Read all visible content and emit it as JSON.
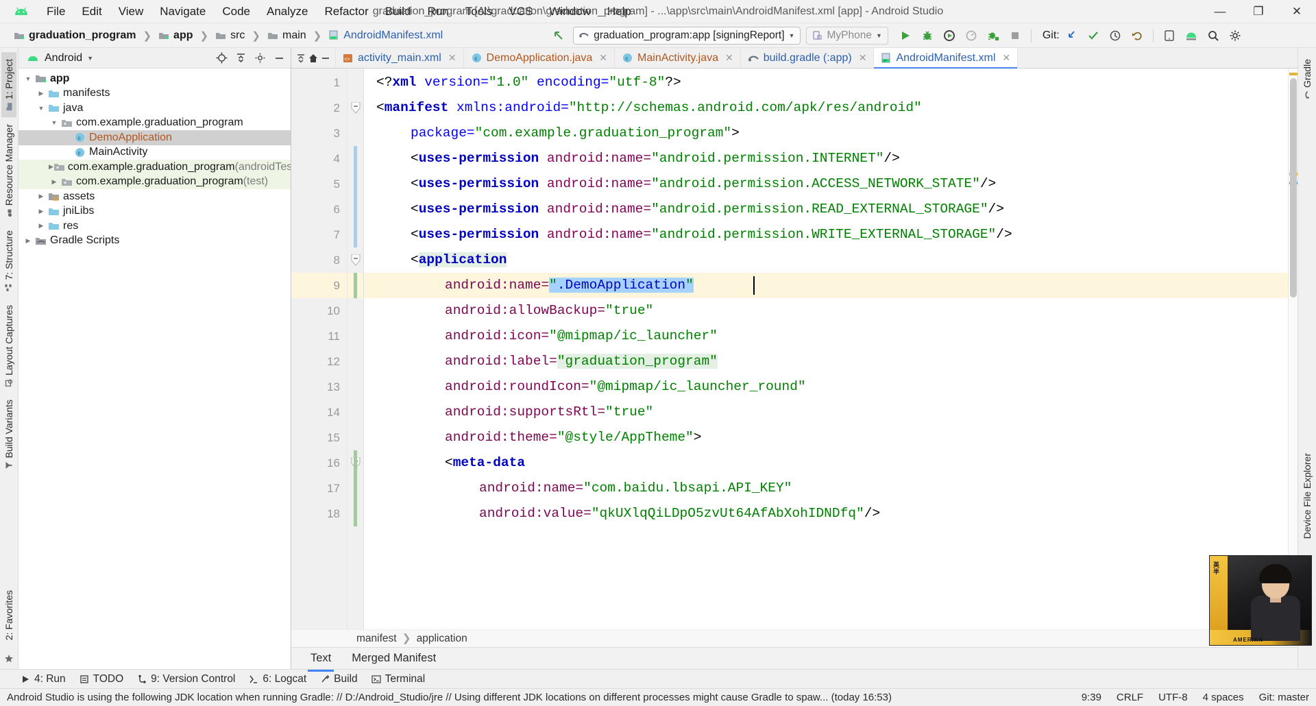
{
  "window": {
    "title": "graduation_program [A:\\graduation\\graduation_program] - ...\\app\\src\\main\\AndroidManifest.xml [app] - Android Studio",
    "minimize": "—",
    "maximize": "❐",
    "close": "✕"
  },
  "menu": [
    "File",
    "Edit",
    "View",
    "Navigate",
    "Code",
    "Analyze",
    "Refactor",
    "Build",
    "Run",
    "Tools",
    "VCS",
    "Window",
    "Help"
  ],
  "breadcrumbs": [
    {
      "label": "graduation_program",
      "icon": "folder-module-icon",
      "bold": true
    },
    {
      "label": "app",
      "icon": "folder-module-icon",
      "bold": true
    },
    {
      "label": "src",
      "icon": "folder-icon",
      "bold": false
    },
    {
      "label": "main",
      "icon": "folder-icon",
      "bold": false
    },
    {
      "label": "AndroidManifest.xml",
      "icon": "manifest-file-icon",
      "bold": false,
      "link": true
    }
  ],
  "toolbar": {
    "run_config": "graduation_program:app [signingReport]",
    "device": "MyPhone",
    "git_label": "Git:",
    "buttons": [
      "run-icon",
      "debug-icon",
      "run-coverage-icon",
      "profiler-icon",
      "attach-debugger-icon",
      "stop-icon"
    ],
    "git_buttons": [
      "update-project-icon",
      "commit-icon",
      "history-icon",
      "rollback-icon"
    ],
    "right_buttons": [
      "avd-manager-icon",
      "sdk-manager-icon",
      "search-everywhere-icon",
      "settings-icon"
    ]
  },
  "left_tool_tabs": [
    {
      "label": "1: Project",
      "icon": "project-icon",
      "active": true
    },
    {
      "label": "Resource Manager",
      "icon": "resource-manager-icon",
      "active": false
    },
    {
      "label": "7: Structure",
      "icon": "structure-icon",
      "active": false
    },
    {
      "label": "Layout Captures",
      "icon": "layout-captures-icon",
      "active": false
    },
    {
      "label": "Build Variants",
      "icon": "build-variants-icon",
      "active": false
    },
    {
      "label": "2: Favorites",
      "icon": "favorites-icon",
      "active": false
    }
  ],
  "right_tool_tabs": [
    {
      "label": "Gradle",
      "icon": "gradle-icon"
    },
    {
      "label": "Device File Explorer",
      "icon": "device-file-explorer-icon"
    }
  ],
  "project_panel": {
    "view_selector": "Android",
    "actions": [
      "locate-icon",
      "collapse-all-icon",
      "settings-icon",
      "hide-icon"
    ],
    "tree": [
      {
        "label": "app",
        "depth": 0,
        "arrow": "open",
        "icon": "module-folder-icon",
        "bold": true,
        "state": "normal"
      },
      {
        "label": "manifests",
        "depth": 1,
        "arrow": "closed",
        "icon": "folder-blue-icon",
        "bold": false,
        "state": "normal"
      },
      {
        "label": "java",
        "depth": 1,
        "arrow": "open",
        "icon": "folder-blue-icon",
        "bold": false,
        "state": "normal"
      },
      {
        "label": "com.example.graduation_program",
        "depth": 2,
        "arrow": "open",
        "icon": "package-icon",
        "bold": false,
        "state": "normal"
      },
      {
        "label": "DemoApplication",
        "depth": 3,
        "arrow": "none",
        "icon": "class-icon",
        "bold": false,
        "state": "selected",
        "color": "orange"
      },
      {
        "label": "MainActivity",
        "depth": 3,
        "arrow": "none",
        "icon": "class-icon",
        "bold": false,
        "state": "normal"
      },
      {
        "label": "com.example.graduation_program",
        "suffix": " (androidTest)",
        "depth": 2,
        "arrow": "closed",
        "icon": "package-icon",
        "bold": false,
        "state": "testsrc"
      },
      {
        "label": "com.example.graduation_program",
        "suffix": " (test)",
        "depth": 2,
        "arrow": "closed",
        "icon": "package-icon",
        "bold": false,
        "state": "testsrc"
      },
      {
        "label": "assets",
        "depth": 1,
        "arrow": "closed",
        "icon": "assets-folder-icon",
        "bold": false,
        "state": "normal"
      },
      {
        "label": "jniLibs",
        "depth": 1,
        "arrow": "closed",
        "icon": "folder-blue-icon",
        "bold": false,
        "state": "normal"
      },
      {
        "label": "res",
        "depth": 1,
        "arrow": "closed",
        "icon": "folder-blue-icon",
        "bold": false,
        "state": "normal"
      },
      {
        "label": "Gradle Scripts",
        "depth": 0,
        "arrow": "closed",
        "icon": "gradle-scripts-icon",
        "bold": false,
        "state": "normal"
      }
    ]
  },
  "editor_tabs": [
    {
      "label": "activity_main.xml",
      "icon": "xml-layout-icon",
      "color": "blue",
      "active": false
    },
    {
      "label": "DemoApplication.java",
      "icon": "class-icon",
      "color": "orange",
      "active": false
    },
    {
      "label": "MainActivity.java",
      "icon": "class-icon",
      "color": "orange",
      "active": false
    },
    {
      "label": "build.gradle (:app)",
      "icon": "gradle-icon",
      "color": "blue",
      "active": false
    },
    {
      "label": "AndroidManifest.xml",
      "icon": "manifest-file-icon",
      "color": "blue",
      "active": true
    }
  ],
  "code": {
    "first_line": 1,
    "lines": [
      {
        "n": 1,
        "indent": 0,
        "tokens": [
          {
            "t": "<?",
            "c": "punc"
          },
          {
            "t": "xml",
            "c": "tag"
          },
          {
            "t": " version=",
            "c": "attr2"
          },
          {
            "t": "\"1.0\"",
            "c": "val"
          },
          {
            "t": " encoding=",
            "c": "attr2"
          },
          {
            "t": "\"utf-8\"",
            "c": "val"
          },
          {
            "t": "?>",
            "c": "punc"
          }
        ]
      },
      {
        "n": 2,
        "indent": 0,
        "tokens": [
          {
            "t": "<",
            "c": "punc"
          },
          {
            "t": "manifest",
            "c": "tag"
          },
          {
            "t": " xmlns:android=",
            "c": "attr2"
          },
          {
            "t": "\"http://schemas.android.com/apk/res/android\"",
            "c": "val"
          }
        ]
      },
      {
        "n": 3,
        "indent": 1,
        "tokens": [
          {
            "t": "package=",
            "c": "attr2"
          },
          {
            "t": "\"com.example.graduation_program\"",
            "c": "val"
          },
          {
            "t": ">",
            "c": "punc"
          }
        ]
      },
      {
        "n": 4,
        "indent": 1,
        "tokens": [
          {
            "t": "<",
            "c": "punc"
          },
          {
            "t": "uses-permission",
            "c": "tag"
          },
          {
            "t": " android:name=",
            "c": "attr"
          },
          {
            "t": "\"android.permission.INTERNET\"",
            "c": "val"
          },
          {
            "t": "/>",
            "c": "punc"
          }
        ]
      },
      {
        "n": 5,
        "indent": 1,
        "tokens": [
          {
            "t": "<",
            "c": "punc"
          },
          {
            "t": "uses-permission",
            "c": "tag"
          },
          {
            "t": " android:name=",
            "c": "attr"
          },
          {
            "t": "\"android.permission.ACCESS_NETWORK_STATE\"",
            "c": "val"
          },
          {
            "t": "/>",
            "c": "punc"
          }
        ]
      },
      {
        "n": 6,
        "indent": 1,
        "tokens": [
          {
            "t": "<",
            "c": "punc"
          },
          {
            "t": "uses-permission",
            "c": "tag"
          },
          {
            "t": " android:name=",
            "c": "attr"
          },
          {
            "t": "\"android.permission.READ_EXTERNAL_STORAGE\"",
            "c": "val"
          },
          {
            "t": "/>",
            "c": "punc"
          }
        ]
      },
      {
        "n": 7,
        "indent": 1,
        "tokens": [
          {
            "t": "<",
            "c": "punc"
          },
          {
            "t": "uses-permission",
            "c": "tag"
          },
          {
            "t": " android:name=",
            "c": "attr"
          },
          {
            "t": "\"android.permission.WRITE_EXTERNAL_STORAGE\"",
            "c": "val"
          },
          {
            "t": "/>",
            "c": "punc"
          }
        ]
      },
      {
        "n": 8,
        "indent": 1,
        "tokens": [
          {
            "t": "<",
            "c": "punc"
          },
          {
            "t": "application",
            "c": "tag-hl"
          }
        ]
      },
      {
        "n": 9,
        "indent": 2,
        "tokens": [
          {
            "t": "android:name=",
            "c": "attr"
          },
          {
            "t": "\"",
            "c": "val-sel"
          },
          {
            "t": ".DemoApplication",
            "c": "ref-sel"
          },
          {
            "t": "\"",
            "c": "val-sel"
          }
        ]
      },
      {
        "n": 10,
        "indent": 2,
        "tokens": [
          {
            "t": "android:allowBackup=",
            "c": "attr"
          },
          {
            "t": "\"true\"",
            "c": "val"
          }
        ]
      },
      {
        "n": 11,
        "indent": 2,
        "tokens": [
          {
            "t": "android:icon=",
            "c": "attr"
          },
          {
            "t": "\"@mipmap/ic_launcher\"",
            "c": "val"
          }
        ]
      },
      {
        "n": 12,
        "indent": 2,
        "tokens": [
          {
            "t": "android:label=",
            "c": "attr"
          },
          {
            "t": "\"graduation_program\"",
            "c": "val-soft"
          }
        ]
      },
      {
        "n": 13,
        "indent": 2,
        "tokens": [
          {
            "t": "android:roundIcon=",
            "c": "attr"
          },
          {
            "t": "\"@mipmap/ic_launcher_round\"",
            "c": "val"
          }
        ]
      },
      {
        "n": 14,
        "indent": 2,
        "tokens": [
          {
            "t": "android:supportsRtl=",
            "c": "attr"
          },
          {
            "t": "\"true\"",
            "c": "val"
          }
        ]
      },
      {
        "n": 15,
        "indent": 2,
        "tokens": [
          {
            "t": "android:theme=",
            "c": "attr"
          },
          {
            "t": "\"@style/AppTheme\"",
            "c": "val"
          },
          {
            "t": ">",
            "c": "punc"
          }
        ]
      },
      {
        "n": 16,
        "indent": 2,
        "tokens": [
          {
            "t": "<",
            "c": "punc"
          },
          {
            "t": "meta-data",
            "c": "tag"
          }
        ]
      },
      {
        "n": 17,
        "indent": 3,
        "tokens": [
          {
            "t": "android:name=",
            "c": "attr"
          },
          {
            "t": "\"com.baidu.lbsapi.API_KEY\"",
            "c": "val"
          }
        ]
      },
      {
        "n": 18,
        "indent": 3,
        "tokens": [
          {
            "t": "android:value=",
            "c": "attr"
          },
          {
            "t": "\"qkUXlqQiLDpO5zvUt64AfAbXohIDNDfq\"",
            "c": "val"
          },
          {
            "t": "/>",
            "c": "punc"
          }
        ]
      }
    ]
  },
  "editor_breadcrumb": [
    "manifest",
    "application"
  ],
  "view_tabs": [
    {
      "label": "Text",
      "active": true
    },
    {
      "label": "Merged Manifest",
      "active": false
    }
  ],
  "bottom_windows": [
    {
      "label": "4: Run",
      "icon": "run-icon"
    },
    {
      "label": "TODO",
      "icon": "todo-icon"
    },
    {
      "label": "9: Version Control",
      "icon": "vcs-icon"
    },
    {
      "label": "6: Logcat",
      "icon": "logcat-icon"
    },
    {
      "label": "Build",
      "icon": "build-icon"
    },
    {
      "label": "Terminal",
      "icon": "terminal-icon"
    }
  ],
  "status": {
    "message": "Android Studio is using the following JDK location when running Gradle: // D:/Android_Studio/jre // Using different JDK locations on different processes might cause Gradle to spaw... (today 16:53)",
    "caret": "9:39",
    "line_sep": "CRLF",
    "encoding": "UTF-8",
    "indent": "4 spaces",
    "branch": "Git: master"
  },
  "colors": {
    "accent": "#4285f4",
    "link": "#2b5fb0",
    "orange": "#b2561d",
    "selection": "#a6d2ff",
    "line_highlight": "#fdf6dd",
    "tree_selected": "#d0d0d0",
    "test_source": "#eef5e4",
    "string": "#008000",
    "tag": "#0000c0",
    "attr": "#7d0552"
  },
  "webcam": {
    "text_vertical": "英半",
    "text_bottom": "AMERIKN"
  }
}
